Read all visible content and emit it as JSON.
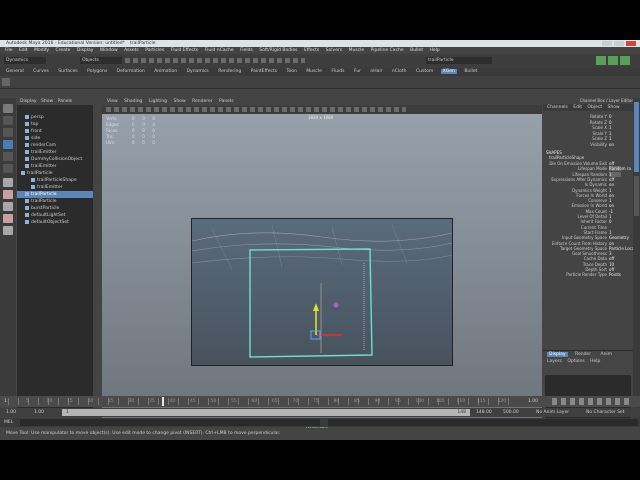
{
  "window": {
    "title": "Autodesk Maya 2016 - Educational Version: untitled*",
    "title_extra": "trailParticle"
  },
  "menubar": [
    "File",
    "Edit",
    "Modify",
    "Create",
    "Display",
    "Window",
    "Assets",
    "Particles",
    "Fluid Effects",
    "Fluid nCache",
    "Fields",
    "Soft/Rigid Bodies",
    "Effects",
    "Solvers",
    "Muscle",
    "Pipeline Cache",
    "Bullet",
    "Help"
  ],
  "statusline": {
    "menuset": "Dynamics",
    "selection_mode": "Objects",
    "search_value": "trailParticle"
  },
  "shelf_tabs": [
    "General",
    "Curves",
    "Surfaces",
    "Polygons",
    "Deformation",
    "Animation",
    "Dynamics",
    "Rendering",
    "PaintEffects",
    "Toon",
    "Muscle",
    "Fluids",
    "Fur",
    "nHair",
    "nCloth",
    "Custom",
    "XGen",
    "Bullet"
  ],
  "shelf_active": "XGen",
  "outliner": {
    "menu": [
      "Display",
      "Show",
      "Panels"
    ],
    "items": [
      {
        "label": "persp",
        "selected": false,
        "indent": 1
      },
      {
        "label": "top",
        "selected": false,
        "indent": 1
      },
      {
        "label": "front",
        "selected": false,
        "indent": 1
      },
      {
        "label": "side",
        "selected": false,
        "indent": 1
      },
      {
        "label": "renderCam",
        "selected": false,
        "indent": 1
      },
      {
        "label": "trailEmitter",
        "selected": false,
        "indent": 1
      },
      {
        "label": "DummyCollisionObject",
        "selected": false,
        "indent": 1
      },
      {
        "label": "trailEmitter",
        "selected": false,
        "indent": 1
      },
      {
        "label": "trailParticle",
        "selected": false,
        "indent": 0
      },
      {
        "label": "trailParticleShape",
        "selected": false,
        "indent": 2
      },
      {
        "label": "trailEmitter",
        "selected": false,
        "indent": 2
      },
      {
        "label": "trailParticle",
        "selected": true,
        "indent": 1
      },
      {
        "label": "trailParticle",
        "selected": false,
        "indent": 1
      },
      {
        "label": "burstParticle",
        "selected": false,
        "indent": 1
      },
      {
        "label": "defaultLightSet",
        "selected": false,
        "indent": 1
      },
      {
        "label": "defaultObjectSet",
        "selected": false,
        "indent": 1
      }
    ]
  },
  "viewport": {
    "menu": [
      "View",
      "Shading",
      "Lighting",
      "Show",
      "Renderer",
      "Panels"
    ],
    "hud_rows": [
      {
        "label": "Verts:",
        "v1": "0",
        "v2": "0",
        "v3": "0"
      },
      {
        "label": "Edges:",
        "v1": "0",
        "v2": "0",
        "v3": "0"
      },
      {
        "label": "Faces:",
        "v1": "0",
        "v2": "0",
        "v3": "0"
      },
      {
        "label": "Tris:",
        "v1": "0",
        "v2": "0",
        "v3": "0"
      },
      {
        "label": "UVs:",
        "v1": "0",
        "v2": "0",
        "v3": "0"
      }
    ],
    "resolution_gate": "1920 x 1080",
    "camera_label": "renderCam"
  },
  "channel_box": {
    "menu": [
      "Channels",
      "Edit",
      "Object",
      "Show"
    ],
    "header_label": "Channel Box / Layer Editor",
    "transform": [
      {
        "label": "Rotate Y",
        "value": "0"
      },
      {
        "label": "Rotate Z",
        "value": "0"
      },
      {
        "label": "Scale X",
        "value": "1"
      },
      {
        "label": "Scale Y",
        "value": "1"
      },
      {
        "label": "Scale Z",
        "value": "1"
      },
      {
        "label": "Visibility",
        "value": "on"
      }
    ],
    "shapes_heading": "SHAPES",
    "shape_name": "trailParticleShape",
    "shape_attrs": [
      {
        "label": "Die On Emission Volume Exit",
        "value": "off",
        "style": "n"
      },
      {
        "label": "Lifespan Mode",
        "value": "Random ra",
        "style": "in"
      },
      {
        "label": "Lifespan Random",
        "value": "1",
        "style": "in"
      },
      {
        "label": "Expressions After Dynamics",
        "value": "off",
        "style": "n"
      },
      {
        "label": "Is Dynamic",
        "value": "on",
        "style": "n"
      },
      {
        "label": "Dynamics Weight",
        "value": "1",
        "style": "n"
      },
      {
        "label": "Forces In World",
        "value": "on",
        "style": "n"
      },
      {
        "label": "Conserve",
        "value": "1",
        "style": "n"
      },
      {
        "label": "Emission In World",
        "value": "on",
        "style": "n"
      },
      {
        "label": "Max Count",
        "value": "-1",
        "style": "n"
      },
      {
        "label": "Level Of Detail",
        "value": "1",
        "style": "n"
      },
      {
        "label": "Inherit Factor",
        "value": "0",
        "style": "n"
      },
      {
        "label": "Current Time",
        "value": "",
        "style": "hl"
      },
      {
        "label": "Start Frame",
        "value": "1",
        "style": "n"
      },
      {
        "label": "Input Geometry Space",
        "value": "Geometry",
        "style": "n"
      },
      {
        "label": "Enforce Count From History",
        "value": "on",
        "style": "n"
      },
      {
        "label": "Target Geometry Space",
        "value": "Particle Local",
        "style": "n"
      },
      {
        "label": "Goal Smoothness",
        "value": "3",
        "style": "n"
      },
      {
        "label": "Cache Data",
        "value": "off",
        "style": "n"
      },
      {
        "label": "Trace Depth",
        "value": "10",
        "style": "n"
      },
      {
        "label": "Depth Sort",
        "value": "off",
        "style": "n"
      },
      {
        "label": "Particle Render Type",
        "value": "Points",
        "style": "n"
      }
    ]
  },
  "side_tabs": [
    "Channel Box / Layer Editor",
    "Attribute Editor"
  ],
  "layer_panel": {
    "tabs": [
      "Display",
      "Render",
      "Anim"
    ],
    "active_tab": "Display",
    "submenu": [
      "Layers",
      "Options",
      "Help"
    ]
  },
  "time_slider": {
    "start_label": "1",
    "current_frame": "1.00",
    "ticks": [
      "5",
      "10",
      "15",
      "20",
      "25",
      "30",
      "35",
      "40",
      "45",
      "50",
      "55",
      "60",
      "65",
      "70",
      "75",
      "80",
      "85",
      "90",
      "95",
      "100",
      "105",
      "110",
      "115",
      "120"
    ]
  },
  "range_slider": {
    "start": "1.00",
    "start2": "1.00",
    "range_start": "1",
    "range_end": "148",
    "end": "148.00",
    "end2": "500.00",
    "anim_layer": "No Anim Layer",
    "char_set": "No Character Set"
  },
  "command_line": {
    "lang": "MEL"
  },
  "help_line": "Move Tool: Use manipulator to move object(s). Use edit mode to change pivot (INSERT). Ctrl+LMB to move perpendicular."
}
